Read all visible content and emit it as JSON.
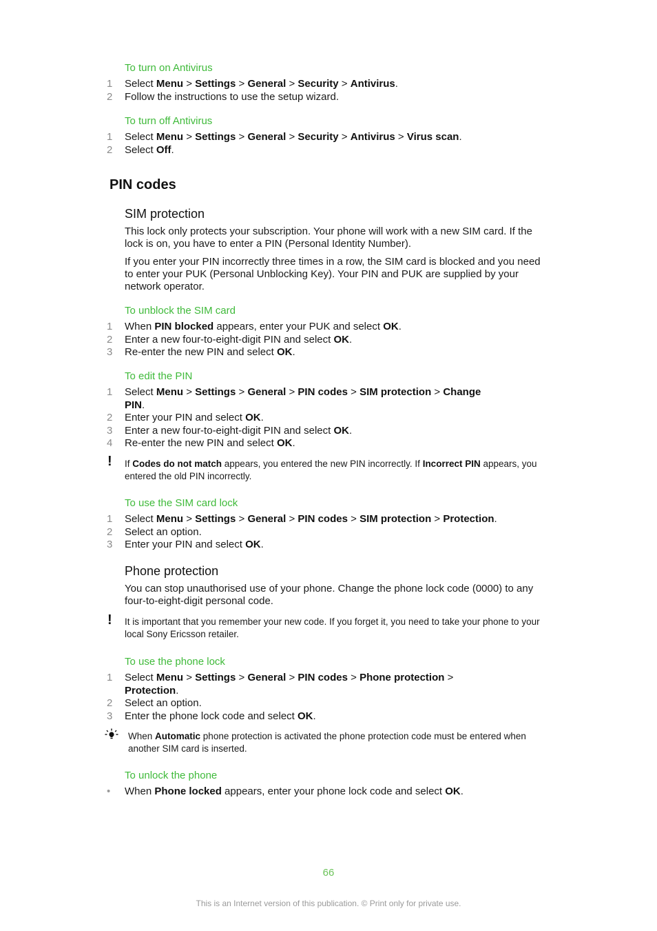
{
  "sections": {
    "turn_on_antivirus": {
      "title": "To turn on Antivirus",
      "steps": [
        {
          "n": "1",
          "parts": [
            [
              "Select ",
              false
            ],
            [
              "Menu",
              true
            ],
            [
              " > ",
              false
            ],
            [
              "Settings",
              true
            ],
            [
              " > ",
              false
            ],
            [
              "General",
              true
            ],
            [
              " > ",
              false
            ],
            [
              "Security",
              true
            ],
            [
              " > ",
              false
            ],
            [
              "Antivirus",
              true
            ],
            [
              ".",
              false
            ]
          ]
        },
        {
          "n": "2",
          "parts": [
            [
              "Follow the instructions to use the setup wizard.",
              false
            ]
          ]
        }
      ]
    },
    "turn_off_antivirus": {
      "title": "To turn off Antivirus",
      "steps": [
        {
          "n": "1",
          "parts": [
            [
              "Select ",
              false
            ],
            [
              "Menu",
              true
            ],
            [
              " > ",
              false
            ],
            [
              "Settings",
              true
            ],
            [
              " > ",
              false
            ],
            [
              "General",
              true
            ],
            [
              " > ",
              false
            ],
            [
              "Security",
              true
            ],
            [
              " > ",
              false
            ],
            [
              "Antivirus",
              true
            ],
            [
              " > ",
              false
            ],
            [
              "Virus scan",
              true
            ],
            [
              ".",
              false
            ]
          ]
        },
        {
          "n": "2",
          "parts": [
            [
              "Select ",
              false
            ],
            [
              "Off",
              true
            ],
            [
              ".",
              false
            ]
          ]
        }
      ]
    },
    "pin_codes": {
      "heading": "PIN codes"
    },
    "sim_protection": {
      "heading": "SIM protection",
      "para1": "This lock only protects your subscription. Your phone will work with a new SIM card. If the lock is on, you have to enter a PIN (Personal Identity Number).",
      "para2": "If you enter your PIN incorrectly three times in a row, the SIM card is blocked and you need to enter your PUK (Personal Unblocking Key). Your PIN and PUK are supplied by your network operator."
    },
    "unblock_sim": {
      "title": "To unblock the SIM card",
      "steps": [
        {
          "n": "1",
          "parts": [
            [
              "When ",
              false
            ],
            [
              "PIN blocked",
              true
            ],
            [
              " appears, enter your PUK and select ",
              false
            ],
            [
              "OK",
              true
            ],
            [
              ".",
              false
            ]
          ]
        },
        {
          "n": "2",
          "parts": [
            [
              "Enter a new four-to-eight-digit PIN and select ",
              false
            ],
            [
              "OK",
              true
            ],
            [
              ".",
              false
            ]
          ]
        },
        {
          "n": "3",
          "parts": [
            [
              "Re-enter the new PIN and select ",
              false
            ],
            [
              "OK",
              true
            ],
            [
              ".",
              false
            ]
          ]
        }
      ]
    },
    "edit_pin": {
      "title": "To edit the PIN",
      "steps": [
        {
          "n": "1",
          "parts": [
            [
              "Select ",
              false
            ],
            [
              "Menu",
              true
            ],
            [
              " > ",
              false
            ],
            [
              "Settings",
              true
            ],
            [
              " > ",
              false
            ],
            [
              "General",
              true
            ],
            [
              " > ",
              false
            ],
            [
              "PIN codes",
              true
            ],
            [
              " > ",
              false
            ],
            [
              "SIM protection",
              true
            ],
            [
              " > ",
              false
            ],
            [
              "Change",
              true
            ]
          ],
          "cont": [
            [
              "PIN",
              true
            ],
            [
              ".",
              false
            ]
          ]
        },
        {
          "n": "2",
          "parts": [
            [
              "Enter your PIN and select ",
              false
            ],
            [
              "OK",
              true
            ],
            [
              ".",
              false
            ]
          ]
        },
        {
          "n": "3",
          "parts": [
            [
              "Enter a new four-to-eight-digit PIN and select ",
              false
            ],
            [
              "OK",
              true
            ],
            [
              ".",
              false
            ]
          ]
        },
        {
          "n": "4",
          "parts": [
            [
              "Re-enter the new PIN and select ",
              false
            ],
            [
              "OK",
              true
            ],
            [
              ".",
              false
            ]
          ]
        }
      ],
      "note": [
        [
          "If ",
          false
        ],
        [
          "Codes do not match",
          true
        ],
        [
          " appears, you entered the new PIN incorrectly. If ",
          false
        ],
        [
          "Incorrect PIN",
          true
        ],
        [
          " appears, you entered the old PIN incorrectly.",
          false
        ]
      ]
    },
    "sim_card_lock": {
      "title": "To use the SIM card lock",
      "steps": [
        {
          "n": "1",
          "parts": [
            [
              "Select ",
              false
            ],
            [
              "Menu",
              true
            ],
            [
              " > ",
              false
            ],
            [
              "Settings",
              true
            ],
            [
              " > ",
              false
            ],
            [
              "General",
              true
            ],
            [
              " > ",
              false
            ],
            [
              "PIN codes",
              true
            ],
            [
              " > ",
              false
            ],
            [
              "SIM protection",
              true
            ],
            [
              " > ",
              false
            ],
            [
              "Protection",
              true
            ],
            [
              ".",
              false
            ]
          ]
        },
        {
          "n": "2",
          "parts": [
            [
              "Select an option.",
              false
            ]
          ]
        },
        {
          "n": "3",
          "parts": [
            [
              "Enter your PIN and select ",
              false
            ],
            [
              "OK",
              true
            ],
            [
              ".",
              false
            ]
          ]
        }
      ]
    },
    "phone_protection": {
      "heading": "Phone protection",
      "para": "You can stop unauthorised use of your phone. Change the phone lock code (0000) to any four-to-eight-digit personal code.",
      "note": "It is important that you remember your new code. If you forget it, you need to take your phone to your local Sony Ericsson retailer."
    },
    "phone_lock": {
      "title": "To use the phone lock",
      "steps": [
        {
          "n": "1",
          "parts": [
            [
              "Select ",
              false
            ],
            [
              "Menu",
              true
            ],
            [
              " > ",
              false
            ],
            [
              "Settings",
              true
            ],
            [
              " > ",
              false
            ],
            [
              "General",
              true
            ],
            [
              " > ",
              false
            ],
            [
              "PIN codes",
              true
            ],
            [
              " > ",
              false
            ],
            [
              "Phone protection",
              true
            ],
            [
              " >",
              false
            ]
          ],
          "cont": [
            [
              "Protection",
              true
            ],
            [
              ".",
              false
            ]
          ]
        },
        {
          "n": "2",
          "parts": [
            [
              "Select an option.",
              false
            ]
          ]
        },
        {
          "n": "3",
          "parts": [
            [
              "Enter the phone lock code and select ",
              false
            ],
            [
              "OK",
              true
            ],
            [
              ".",
              false
            ]
          ]
        }
      ],
      "tip": [
        [
          "When ",
          false
        ],
        [
          "Automatic",
          true
        ],
        [
          " phone protection is activated the phone protection code must be entered when another SIM card is inserted.",
          false
        ]
      ]
    },
    "unlock_phone": {
      "title": "To unlock the phone",
      "bullet": "•",
      "parts": [
        [
          "When ",
          false
        ],
        [
          "Phone locked",
          true
        ],
        [
          " appears, enter your phone lock code and select ",
          false
        ],
        [
          "OK",
          true
        ],
        [
          ".",
          false
        ]
      ]
    }
  },
  "page_number": "66",
  "footer": "This is an Internet version of this publication. © Print only for private use.",
  "colors": {
    "accent": "#3fba3a",
    "text": "#1a1a1a",
    "number": "#8a8a8a",
    "footer": "#9a9a9a"
  }
}
